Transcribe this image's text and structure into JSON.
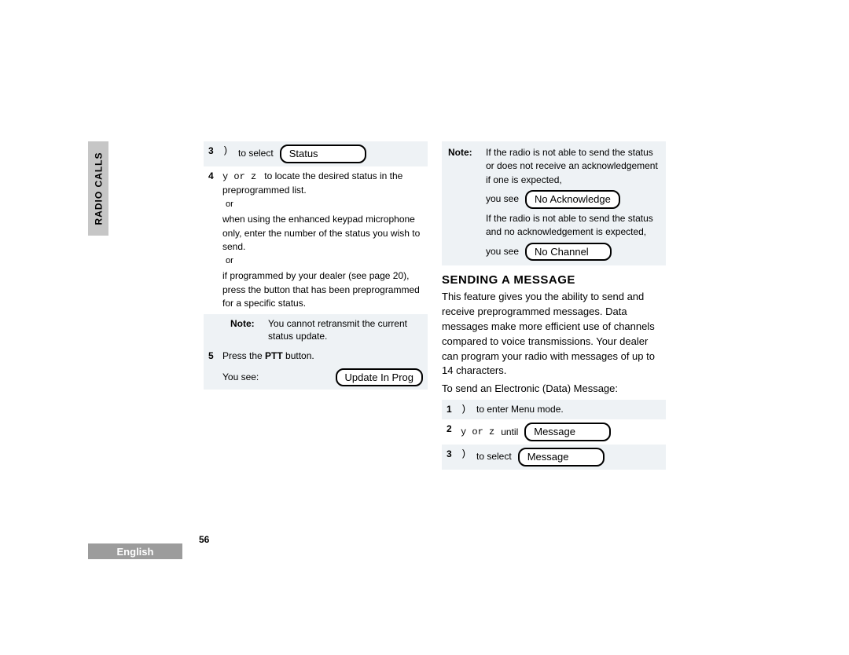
{
  "sidebar": {
    "label": "RADIO CALLS"
  },
  "left_col": {
    "row3": {
      "num": "3",
      "key": ")",
      "action": "to select",
      "lozenge": "Status"
    },
    "row4": {
      "num": "4",
      "keys": "y   or   z",
      "line1": "to locate the desired status in the preprogrammed list.",
      "or1": "or",
      "line2": "when using the enhanced keypad microphone only, enter the number of the status you wish to send.",
      "or2": "or",
      "line3": "if programmed by your dealer (see page 20), press the button that has been preprogrammed for a specific status."
    },
    "note1": {
      "label": "Note:",
      "body": "You cannot retransmit the current status update."
    },
    "row5": {
      "num": "5",
      "line1a": "Press the ",
      "line1b": "PTT",
      "line1c": " button.",
      "yousee": "You see:",
      "lozenge": "Update In Prog"
    }
  },
  "right_col": {
    "note": {
      "label": "Note:",
      "line1": "If the radio is not able to send the status or does not receive an acknowledgement if one is expected,",
      "yousee1": "you see",
      "lozenge1": "No Acknowledge",
      "line2": "If the radio is not able to send the status and no acknowledgement is expected,",
      "yousee2": "you see",
      "lozenge2": "No Channel"
    },
    "heading": "SENDING A MESSAGE",
    "para": "This feature gives you the ability to send and receive preprogrammed messages. Data messages make more efficient use of channels compared to voice transmissions. Your dealer can program your radio with messages of up to 14 characters.",
    "lead": "To send an Electronic (Data) Message:",
    "row1": {
      "num": "1",
      "key": ")",
      "action": "to enter Menu mode."
    },
    "row2": {
      "num": "2",
      "keys": "y   or   z",
      "until": "until",
      "lozenge": "Message"
    },
    "row3": {
      "num": "3",
      "key": ")",
      "action": "to select",
      "lozenge": "Message"
    }
  },
  "pagenum": "56",
  "language": "English"
}
